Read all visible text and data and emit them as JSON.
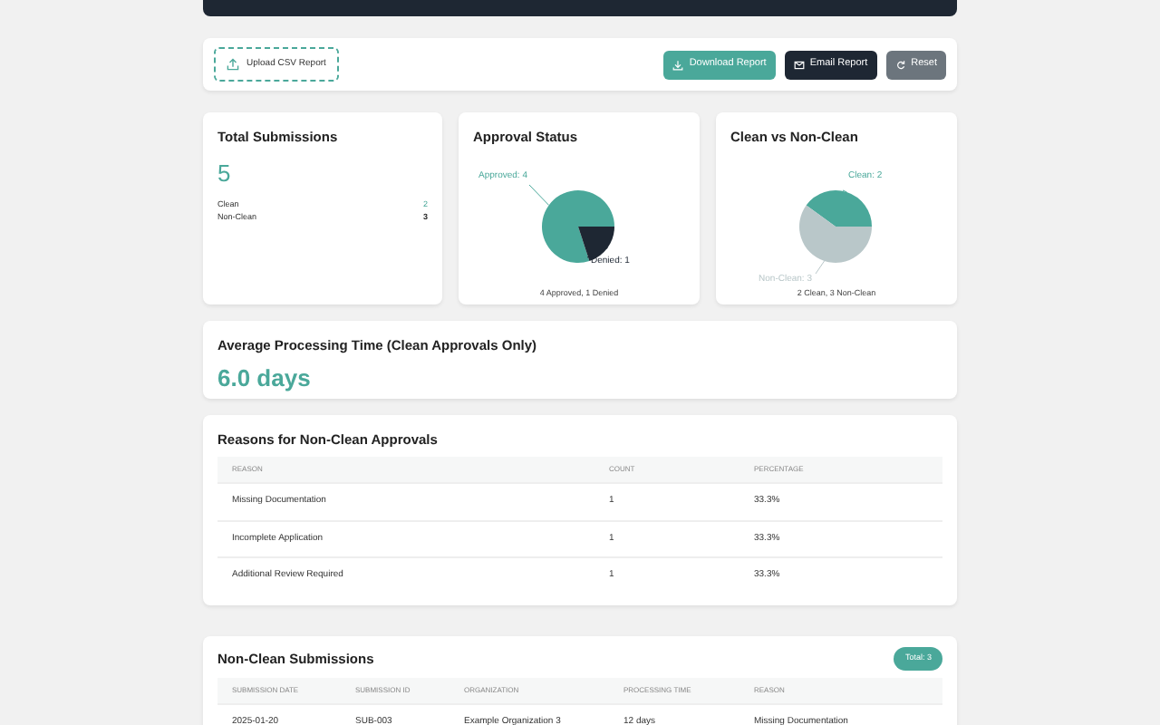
{
  "toolbar": {
    "upload_label": "Upload CSV Report",
    "buttons": [
      {
        "label": "Download Report",
        "kind": "download"
      },
      {
        "label": "Email Report",
        "kind": "email"
      },
      {
        "label": "Reset",
        "kind": "reset"
      }
    ]
  },
  "summary": {
    "title": "Total Submissions",
    "total": "5",
    "rows": [
      {
        "label": "Clean",
        "value": "2",
        "kind": "clean"
      },
      {
        "label": "Non-Clean",
        "value": "3",
        "kind": "nonclean"
      }
    ]
  },
  "approval_status": {
    "title": "Approval Status",
    "caption": "4 Approved, 1 Denied",
    "slice_labels": [
      "Approved: 4",
      "Denied: 1"
    ],
    "chart_data": {
      "type": "pie",
      "series": [
        {
          "values": [
            80,
            20
          ]
        }
      ],
      "colors": [
        "#4aa89a",
        "#1e2733"
      ]
    }
  },
  "clean_vs_nonclean": {
    "title": "Clean vs Non-Clean",
    "caption": "2 Clean, 3 Non-Clean",
    "slice_labels": [
      "Clean: 2",
      "Non-Clean: 3"
    ],
    "chart_data": {
      "type": "pie",
      "series": [
        {
          "values": [
            40,
            60
          ]
        }
      ],
      "colors": [
        "#4aa89a",
        "#b9c7c9"
      ]
    }
  },
  "avg_processing": {
    "title": "Average Processing Time (Clean Approvals Only)",
    "value": "6.0 days"
  },
  "reasons": {
    "title": "Reasons for Non-Clean Approvals",
    "columns": [
      "REASON",
      "COUNT",
      "PERCENTAGE"
    ],
    "rows": [
      [
        "Missing Documentation",
        "1",
        "33.3%"
      ],
      [
        "Incomplete Application",
        "1",
        "33.3%"
      ],
      [
        "Additional Review Required",
        "1",
        "33.3%"
      ]
    ]
  },
  "non_clean": {
    "title": "Non-Clean Submissions",
    "badge": "Total: 3",
    "columns": [
      "SUBMISSION DATE",
      "SUBMISSION ID",
      "ORGANIZATION",
      "PROCESSING TIME",
      "REASON"
    ],
    "rows": [
      [
        "2025-01-20",
        "SUB-003",
        "Example Organization 3",
        "12 days",
        "Missing Documentation"
      ]
    ]
  }
}
